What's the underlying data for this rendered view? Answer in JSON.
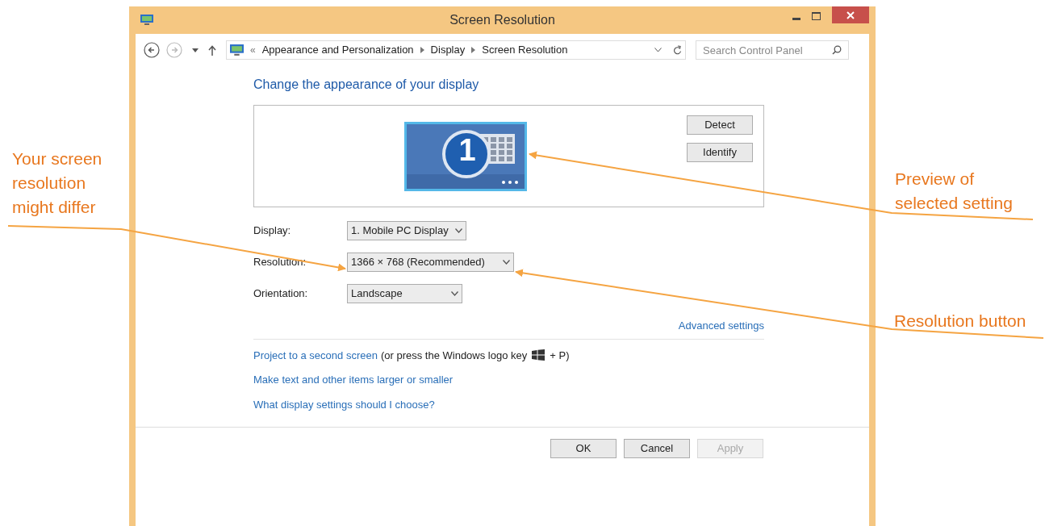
{
  "window": {
    "title": "Screen Resolution"
  },
  "nav_buttons": [
    {
      "kind": "back",
      "disabled": false
    },
    {
      "kind": "forward",
      "disabled": true
    },
    {
      "kind": "recent",
      "disabled": false
    },
    {
      "kind": "up",
      "disabled": false
    }
  ],
  "address_bar": {
    "prefix": "«",
    "crumbs": [
      "Appearance and Personalization",
      "Display",
      "Screen Resolution"
    ]
  },
  "search": {
    "placeholder": "Search Control Panel"
  },
  "heading": "Change the appearance of your display",
  "preview": {
    "monitor_label": "1",
    "buttons": [
      "Detect",
      "Identify"
    ]
  },
  "settings": [
    {
      "label": "Display:",
      "value": "1. Mobile PC Display"
    },
    {
      "label": "Resolution:",
      "value": "1366 × 768 (Recommended)"
    },
    {
      "label": "Orientation:",
      "value": "Landscape"
    }
  ],
  "advanced_link": "Advanced settings",
  "project_line": {
    "link": "Project to a second screen",
    "before_key": "(or press the Windows logo key",
    "after_key": "+ P)"
  },
  "links": [
    "Make text and other items larger or smaller",
    "What display settings should I choose?"
  ],
  "buttons": [
    {
      "label": "OK",
      "disabled": false
    },
    {
      "label": "Cancel",
      "disabled": false
    },
    {
      "label": "Apply",
      "disabled": true
    }
  ],
  "callouts": [
    {
      "kind": "left",
      "text": "Your screen resolution might differ"
    },
    {
      "kind": "preview",
      "text": "Preview of selected setting"
    },
    {
      "kind": "resolution",
      "text": "Resolution button"
    }
  ]
}
